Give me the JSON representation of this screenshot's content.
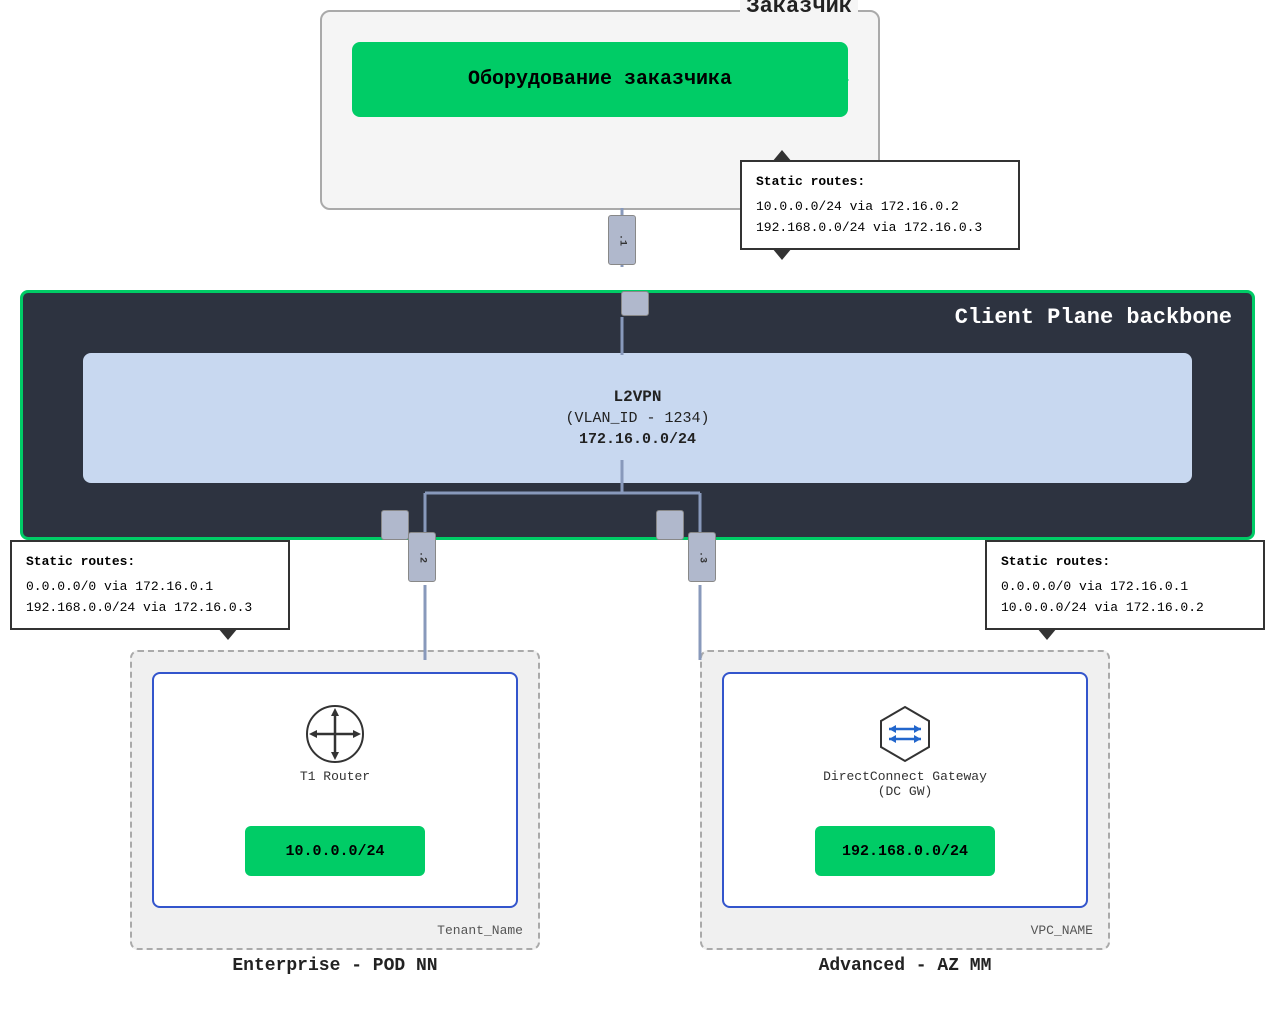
{
  "zakazchik": {
    "title": "Заказчик",
    "equipment_label": "Оборудование заказчика"
  },
  "static_routes_top": {
    "title": "Static routes:",
    "route1": "10.0.0.0/24 via 172.16.0.2",
    "route2": "192.168.0.0/24 via 172.16.0.3"
  },
  "backbone": {
    "title": "Client Plane backbone",
    "l2vpn_label": "L2VPN",
    "vlan_label": "(VLAN_ID - 1234)",
    "ip_label": "172.16.0.0/24"
  },
  "ports": {
    "p1": ".1",
    "p2": ".2",
    "p3": ".3"
  },
  "static_routes_left": {
    "title": "Static routes:",
    "route1": "0.0.0.0/0 via 172.16.0.1",
    "route2": "192.168.0.0/24 via 172.16.0.3"
  },
  "static_routes_right": {
    "title": "Static routes:",
    "route1": "0.0.0.0/0 via 172.16.0.1",
    "route2": "10.0.0.0/24 via 172.16.0.2"
  },
  "enterprise": {
    "router_label": "T1 Router",
    "subnet": "10.0.0.0/24",
    "tenant": "Tenant_Name",
    "title": "Enterprise - POD NN"
  },
  "advanced": {
    "gw_label": "DirectConnect Gateway",
    "gw_label2": "(DC GW)",
    "subnet": "192.168.0.0/24",
    "vpc": "VPC_NAME",
    "title": "Advanced - AZ MM"
  }
}
